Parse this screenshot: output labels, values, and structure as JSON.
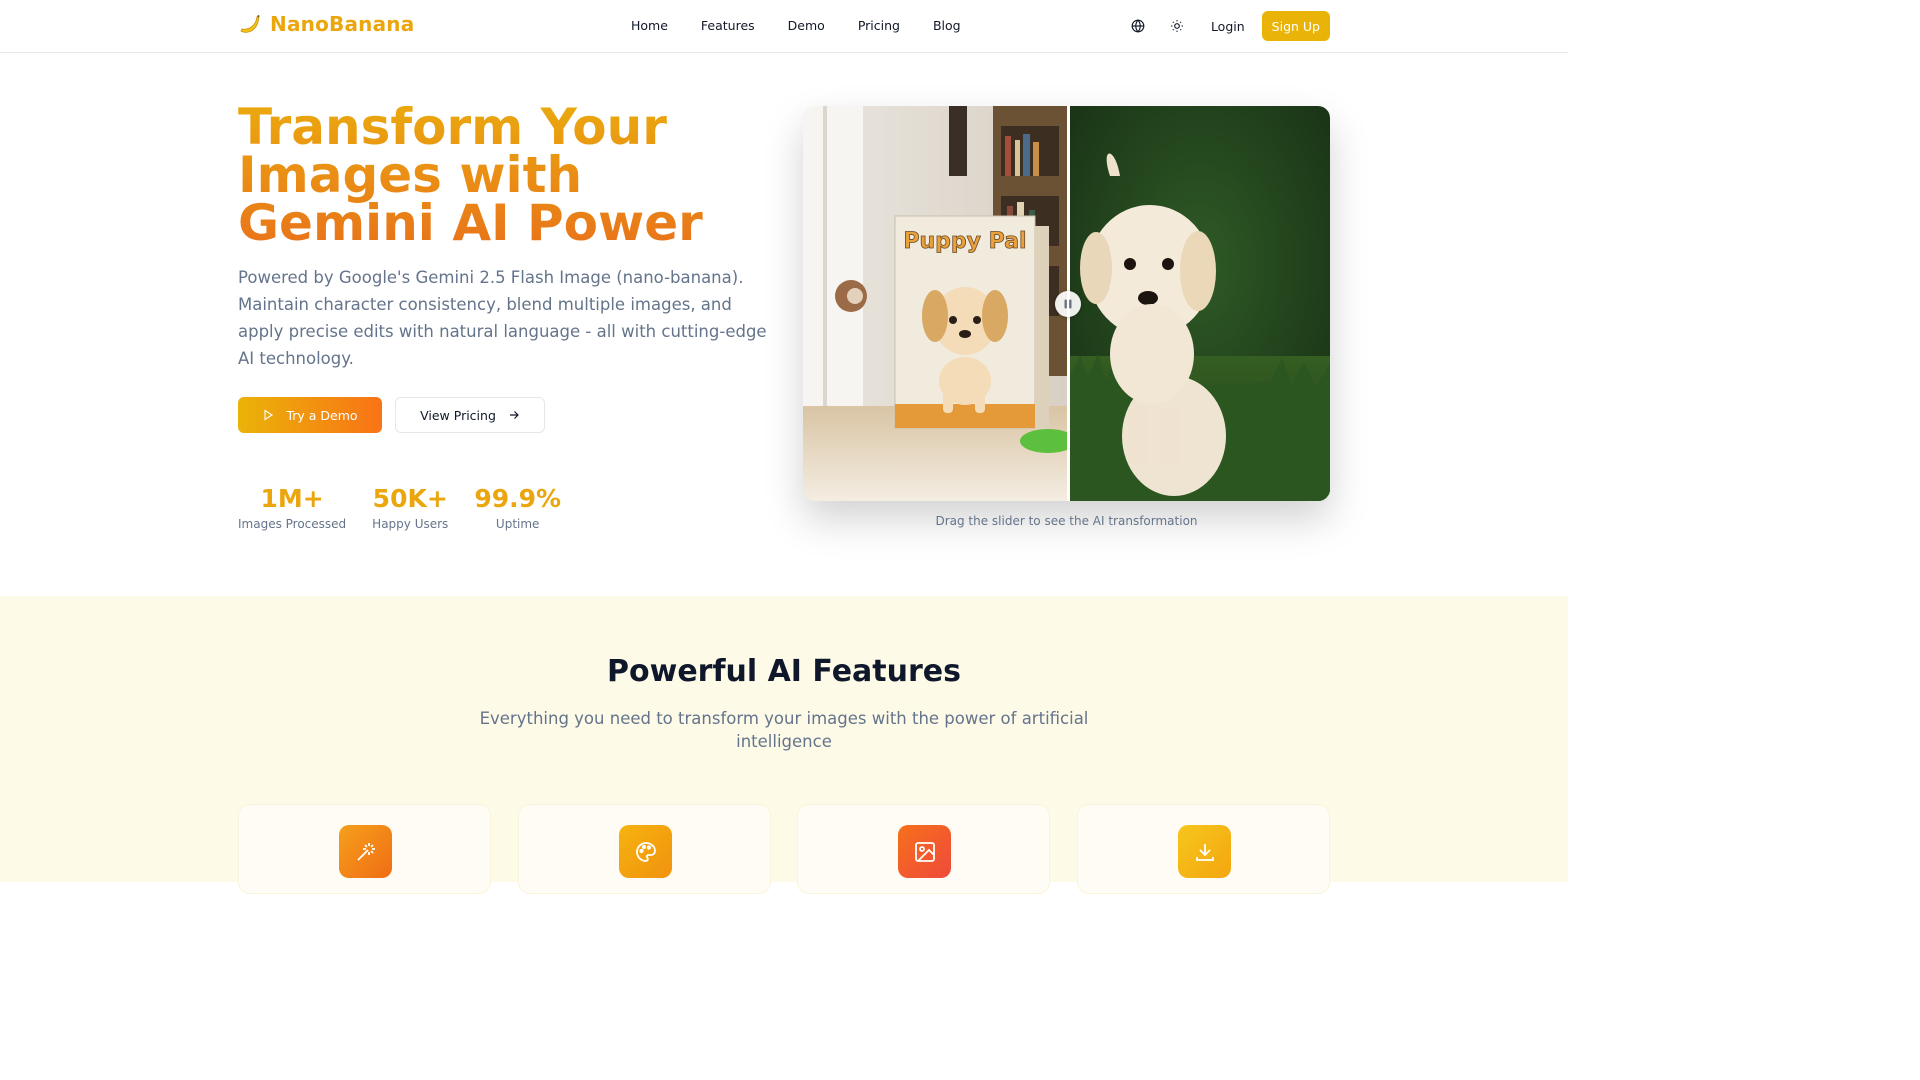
{
  "header": {
    "brand": "NanoBanana",
    "nav": [
      "Home",
      "Features",
      "Demo",
      "Pricing",
      "Blog"
    ],
    "login": "Login",
    "signup": "Sign Up",
    "icons": [
      "globe-icon",
      "sun-icon"
    ]
  },
  "hero": {
    "title": "Transform Your Images with Gemini AI Power",
    "subtitle": "Powered by Google's Gemini 2.5 Flash Image (nano-banana). Maintain character consistency, blend multiple images, and apply precise edits with natural language - all with cutting-edge AI technology.",
    "cta_primary": "Try a Demo",
    "cta_secondary": "View Pricing",
    "stats": [
      {
        "value": "1M+",
        "label": "Images Processed"
      },
      {
        "value": "50K+",
        "label": "Happy Users"
      },
      {
        "value": "99.9%",
        "label": "Uptime"
      }
    ]
  },
  "compare": {
    "box_text": "Puppy Pal",
    "caption": "Drag the slider to see the AI transformation",
    "slider_position": 0.5
  },
  "features": {
    "title": "Powerful AI Features",
    "subtitle": "Everything you need to transform your images with the power of artificial intelligence",
    "card_icons": [
      "magic-wand-icon",
      "palette-icon",
      "image-icon",
      "download-icon"
    ]
  },
  "colors": {
    "brand": "#eaa60c",
    "accent_orange": "#f97316",
    "cream": "#fefae8"
  }
}
